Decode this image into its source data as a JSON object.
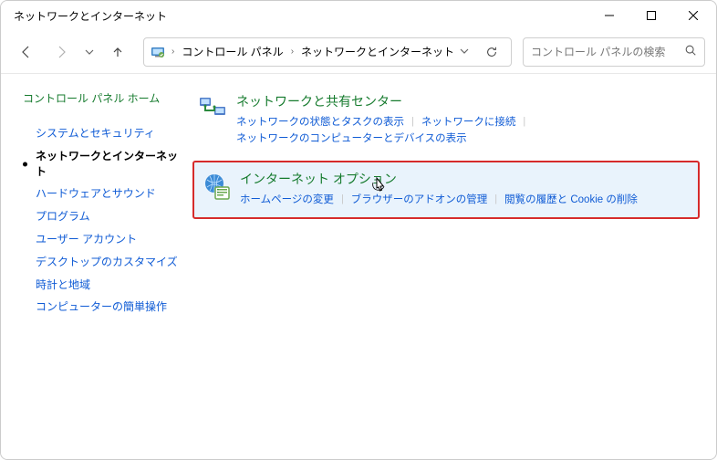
{
  "window": {
    "title": "ネットワークとインターネット"
  },
  "address": {
    "segments": [
      "コントロール パネル",
      "ネットワークとインターネット"
    ]
  },
  "search": {
    "placeholder": "コントロール パネルの検索"
  },
  "sidebar": {
    "home": "コントロール パネル ホーム",
    "items": [
      {
        "label": "システムとセキュリティ",
        "active": false
      },
      {
        "label": "ネットワークとインターネット",
        "active": true
      },
      {
        "label": "ハードウェアとサウンド",
        "active": false
      },
      {
        "label": "プログラム",
        "active": false
      },
      {
        "label": "ユーザー アカウント",
        "active": false
      },
      {
        "label": "デスクトップのカスタマイズ",
        "active": false
      },
      {
        "label": "時計と地域",
        "active": false
      },
      {
        "label": "コンピューターの簡単操作",
        "active": false
      }
    ]
  },
  "categories": [
    {
      "title": "ネットワークと共有センター",
      "links": [
        "ネットワークの状態とタスクの表示",
        "ネットワークに接続",
        "ネットワークのコンピューターとデバイスの表示"
      ],
      "highlight": false
    },
    {
      "title": "インターネット オプション",
      "links": [
        "ホームページの変更",
        "ブラウザーのアドオンの管理",
        "閲覧の履歴と Cookie の削除"
      ],
      "highlight": true
    }
  ]
}
